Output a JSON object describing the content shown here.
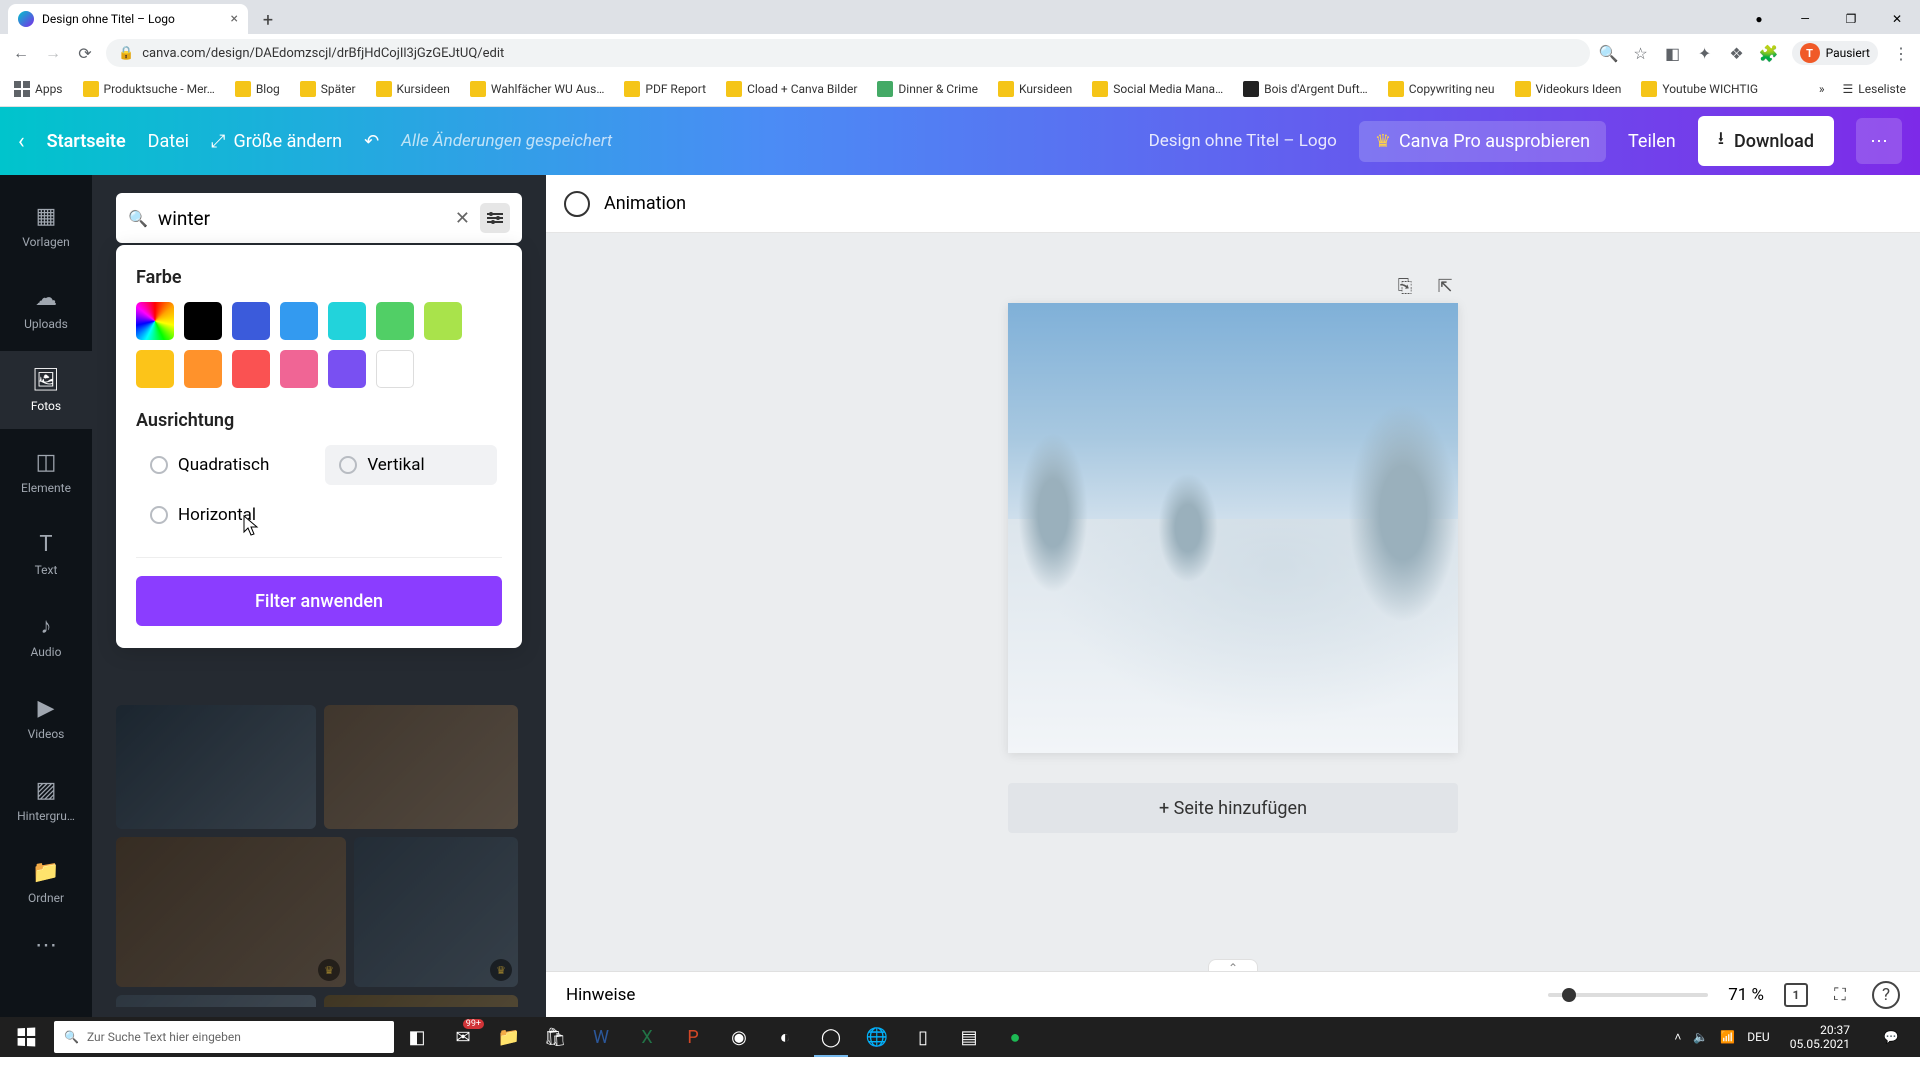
{
  "browser": {
    "tab_title": "Design ohne Titel – Logo",
    "url": "canva.com/design/DAEdomzscjl/drBfjHdCojIl3jGzGEJtUQ/edit",
    "profile_status": "Pausiert",
    "profile_initial": "T",
    "bookmarks": [
      "Apps",
      "Produktsuche - Mer…",
      "Blog",
      "Später",
      "Kursideen",
      "Wahlfächer WU Aus…",
      "PDF Report",
      "Cload + Canva Bilder",
      "Dinner & Crime",
      "Kursideen",
      "Social Media Mana…",
      "Bois d'Argent Duft…",
      "Copywriting neu",
      "Videokurs Ideen",
      "Youtube WICHTIG"
    ],
    "reading_list": "Leseliste"
  },
  "canva_bar": {
    "home": "Startseite",
    "file": "Datei",
    "resize": "Größe ändern",
    "saved": "Alle Änderungen gespeichert",
    "doc_title": "Design ohne Titel – Logo",
    "pro": "Canva Pro ausprobieren",
    "share": "Teilen",
    "download": "Download"
  },
  "rail": {
    "items": [
      "Vorlagen",
      "Uploads",
      "Fotos",
      "Elemente",
      "Text",
      "Audio",
      "Videos",
      "Hintergru…",
      "Ordner"
    ],
    "active_index": 2
  },
  "search": {
    "value": "winter",
    "placeholder": ""
  },
  "filter": {
    "color_label": "Farbe",
    "colors": [
      "rainbow",
      "#000000",
      "#3b5bdb",
      "#339af0",
      "#22b8cf",
      "#51cf66",
      "#a9e34b",
      "#fcc419",
      "#ff922b",
      "#fa5252",
      "#f06595",
      "#7950f2",
      "#ffffff"
    ],
    "orientation_label": "Ausrichtung",
    "orientation_options": [
      "Quadratisch",
      "Vertikal",
      "Horizontal"
    ],
    "apply": "Filter anwenden"
  },
  "canvas": {
    "animation": "Animation",
    "add_page": "+ Seite hinzufügen",
    "notes": "Hinweise",
    "zoom": "71 %"
  },
  "taskbar": {
    "search_placeholder": "Zur Suche Text hier eingeben",
    "lang": "DEU",
    "time": "20:37",
    "date": "05.05.2021",
    "badge": "99+"
  }
}
